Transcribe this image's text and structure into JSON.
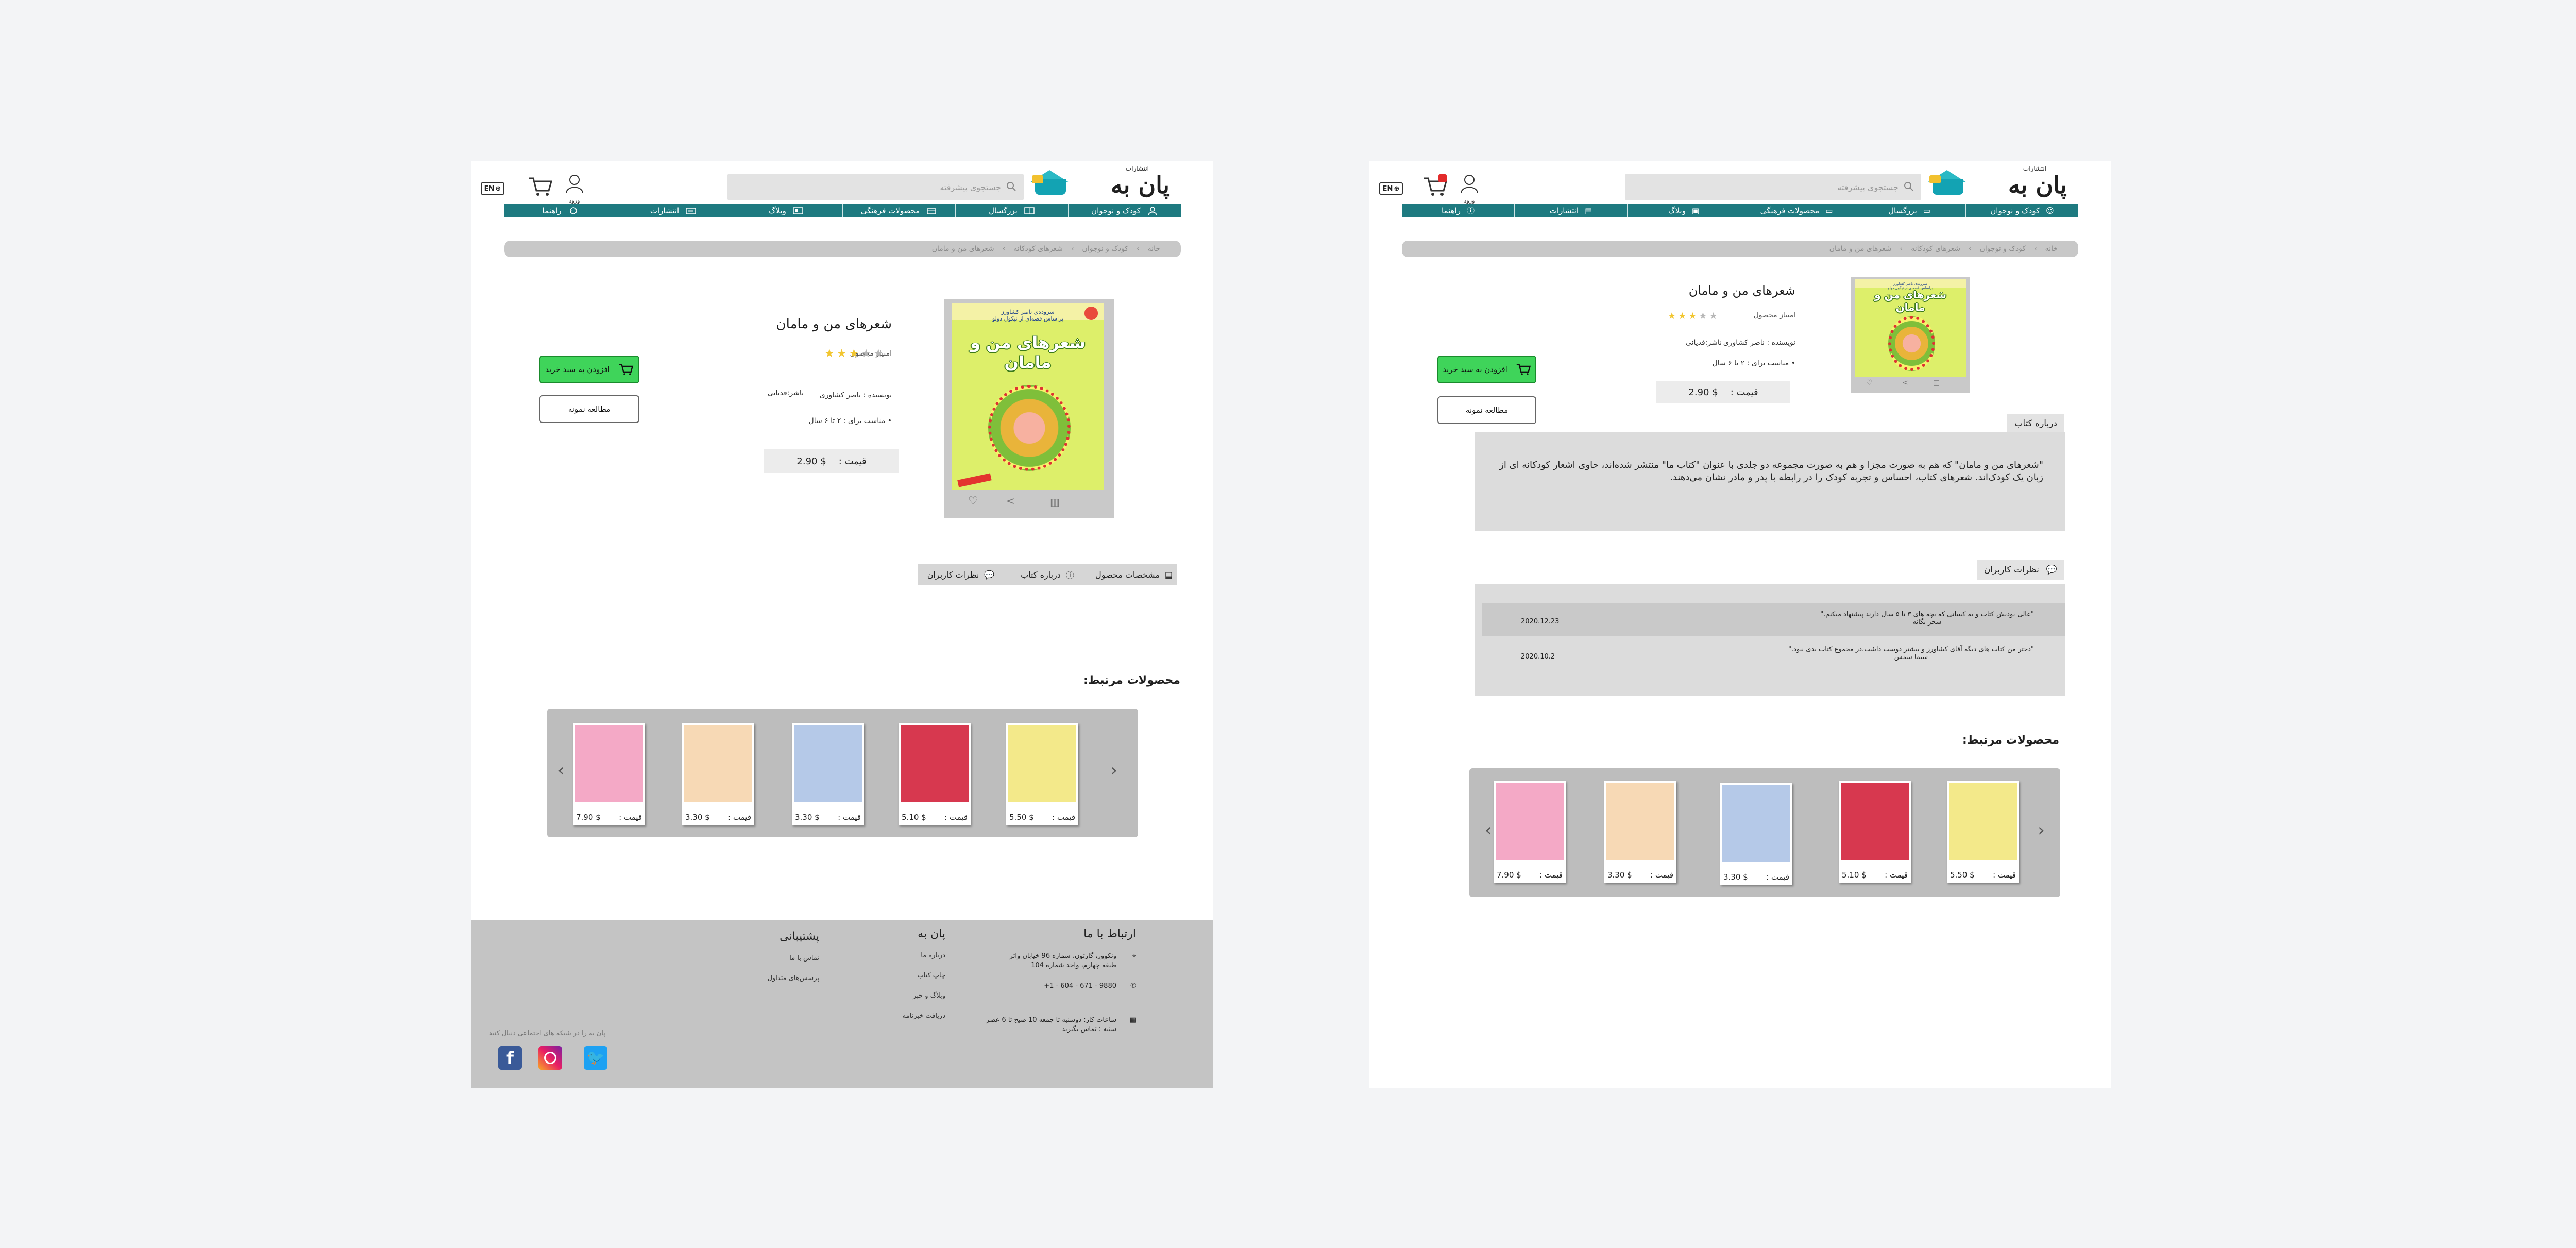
{
  "header": {
    "logo_small": "انتشارات",
    "logo_main": "پان به",
    "search_placeholder": "جستجوی پیشرفته",
    "account_label": "ورود",
    "lang_label": "EN"
  },
  "nav": {
    "items": [
      {
        "label": "کودک و نوجوان",
        "icon": "child-icon"
      },
      {
        "label": "بزرگسال",
        "icon": "book-icon"
      },
      {
        "label": "محصولات فرهنگی",
        "icon": "gift-icon"
      },
      {
        "label": "وبلاگ",
        "icon": "blog-icon"
      },
      {
        "label": "انتشارات",
        "icon": "press-icon"
      },
      {
        "label": "راهنما",
        "icon": "help-icon"
      }
    ]
  },
  "breadcrumb": {
    "items": [
      "خانه",
      "کودک و نوجوان",
      "شعرهای کودکانه",
      "شعرهای من و مامان"
    ]
  },
  "product": {
    "title": "شعرهای من و مامان",
    "rating_label": "امتیاز محصول",
    "rating": 3,
    "rating_max": 5,
    "author": "نویسنده : ناصر کشاوری",
    "illustrator": "ناشر:قدیانی",
    "age": "مناسب برای : ۲ تا ۶ سال",
    "price_label": "قیمت :",
    "price": "$ 2.90",
    "add_to_cart": "افزودن به سبد خرید",
    "read_sample": "مطالعه نمونه",
    "cover_sub": "سروده‌ی ناصر کشاورز\nبراساس قصه‌ای از نیکول دولو",
    "cover_title": "شعرهای من و مامان"
  },
  "tabs": [
    {
      "label": "مشخصات محصول",
      "icon": "spec-icon"
    },
    {
      "label": "درباره کتاب",
      "icon": "info-icon"
    },
    {
      "label": "نظرات کاربران",
      "icon": "comments-icon"
    }
  ],
  "about": {
    "label": "درباره کتاب",
    "text": "\"شعرهای من و مامان\" که هم به صورت مجزا و هم به صورت مجموعه دو جلدی با عنوان \"کتاب ما\" منتشر شده‌اند، حاوی اشعار کودکانه ای از زبان یک کودک‌اند. شعرهای کتاب، احساس و تجربه کودک را در رابطه با پدر و مادر نشان می‌دهند."
  },
  "comments": {
    "label": "نظرات کاربران",
    "items": [
      {
        "text": "\"عالی بودنش کتاب و به کسانی که بچه های ۳ تا ۵ سال دارند پیشنهاد میکنم.\"",
        "author": "سحر یگانه",
        "date": "2020.12.23"
      },
      {
        "text": "\"دختر من کتاب های دیگه آقای کشاورز و بیشتر دوست داشت،در مجموع کتاب بدی نبود.\"",
        "author": "شیما شمس",
        "date": "2020.10.2"
      }
    ]
  },
  "related": {
    "title": "محصولات مرتبط:",
    "price_label": "قیمت :",
    "items": [
      {
        "price": "$ 5.50",
        "color": "#f3e98a"
      },
      {
        "price": "$ 5.10",
        "color": "#d7384f"
      },
      {
        "price": "$ 3.30",
        "color": "#b5c9e8"
      },
      {
        "price": "$ 3.30",
        "color": "#f7d9b5"
      },
      {
        "price": "$ 7.90",
        "color": "#f4a9c6"
      }
    ]
  },
  "footer": {
    "contact_title": "ارتباط با ما",
    "address": "ونکوور، گازتون، شماره 96 خیابان واتر\nطبقه چهارم، واحد شماره 104",
    "phone": "+1 - 604 - 671 - 9880",
    "hours": "ساعات کار: دوشنبه تا جمعه 10 صبح تا 6 عصر\nشنبه : تماس بگیرید",
    "panbeh_title": "پان به",
    "panbeh_links": [
      "درباره ما",
      "چاپ کتاب",
      "وبلاگ و خبر",
      "دریافت خبرنامه"
    ],
    "support_title": "پشتیبانی",
    "support_links": [
      "تماس با ما",
      "پرسش‌های متداول"
    ],
    "social_text": "پان به را در شبکه های اجتماعی دنبال کنید",
    "social": [
      "twitter-icon",
      "instagram-icon",
      "facebook-icon"
    ]
  },
  "colors": {
    "nav": "#1e7a80",
    "cart_button": "#3fd45a",
    "footer": "#c4c4c4",
    "star_on": "#f2c630",
    "star_off": "#b7b7b7"
  }
}
